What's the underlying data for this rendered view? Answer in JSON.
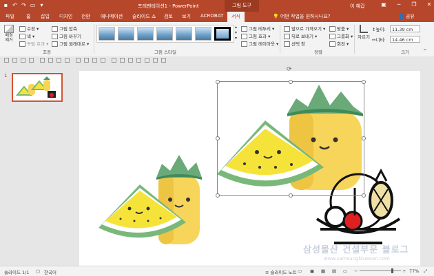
{
  "titlebar": {
    "title": "프레젠테이션1 - PowerPoint",
    "context_tab": "그림 도구",
    "user": "이 혜갑",
    "minimize": "─",
    "restore": "❐",
    "close": "✕"
  },
  "tabs": [
    {
      "label": "파일"
    },
    {
      "label": "홈"
    },
    {
      "label": "삽입"
    },
    {
      "label": "디자인"
    },
    {
      "label": "전환"
    },
    {
      "label": "애니메이션"
    },
    {
      "label": "슬라이드 쇼"
    },
    {
      "label": "검토"
    },
    {
      "label": "보기"
    },
    {
      "label": "ACROBAT"
    },
    {
      "label": "서식"
    }
  ],
  "tellme": "어떤 작업을 원하시나요?",
  "share": "공유",
  "ribbon": {
    "remove_bg": "배경\n제거",
    "corrections": "수정",
    "color": "색",
    "artistic": "꾸밈 효과",
    "compress": "그림 압축",
    "change": "그림 바꾸기",
    "reset": "그림 원래대로",
    "group_adjust": "조정",
    "group_styles": "그림 스타일",
    "border": "그림 테두리",
    "effects": "그림 효과",
    "layout": "그림 레이아웃",
    "bring_forward": "앞으로 가져오기",
    "send_backward": "뒤로 보내기",
    "selection_pane": "선택 창",
    "align": "맞춤",
    "group": "그룹화",
    "rotate": "회전",
    "group_arrange": "정렬",
    "crop": "자르기",
    "height_label": "높이:",
    "height_value": "11.39 cm",
    "width_label": "너비:",
    "width_value": "14.46 cm",
    "group_size": "크기"
  },
  "thumb": {
    "number": "1"
  },
  "status": {
    "slide": "슬라이드 1/1",
    "language": "한국어",
    "notes": "슬라이드 노트",
    "zoom": "77%"
  },
  "watermark": {
    "text": "삼성물산 건설부문 블로그",
    "url": "www.samsungblueoan.com"
  },
  "colors": {
    "accent": "#b7472a",
    "watermelon_yellow": "#f6e33a",
    "rind_green": "#7ab87a",
    "pineapple": "#f7d55b",
    "leaf": "#4c9a6a"
  }
}
